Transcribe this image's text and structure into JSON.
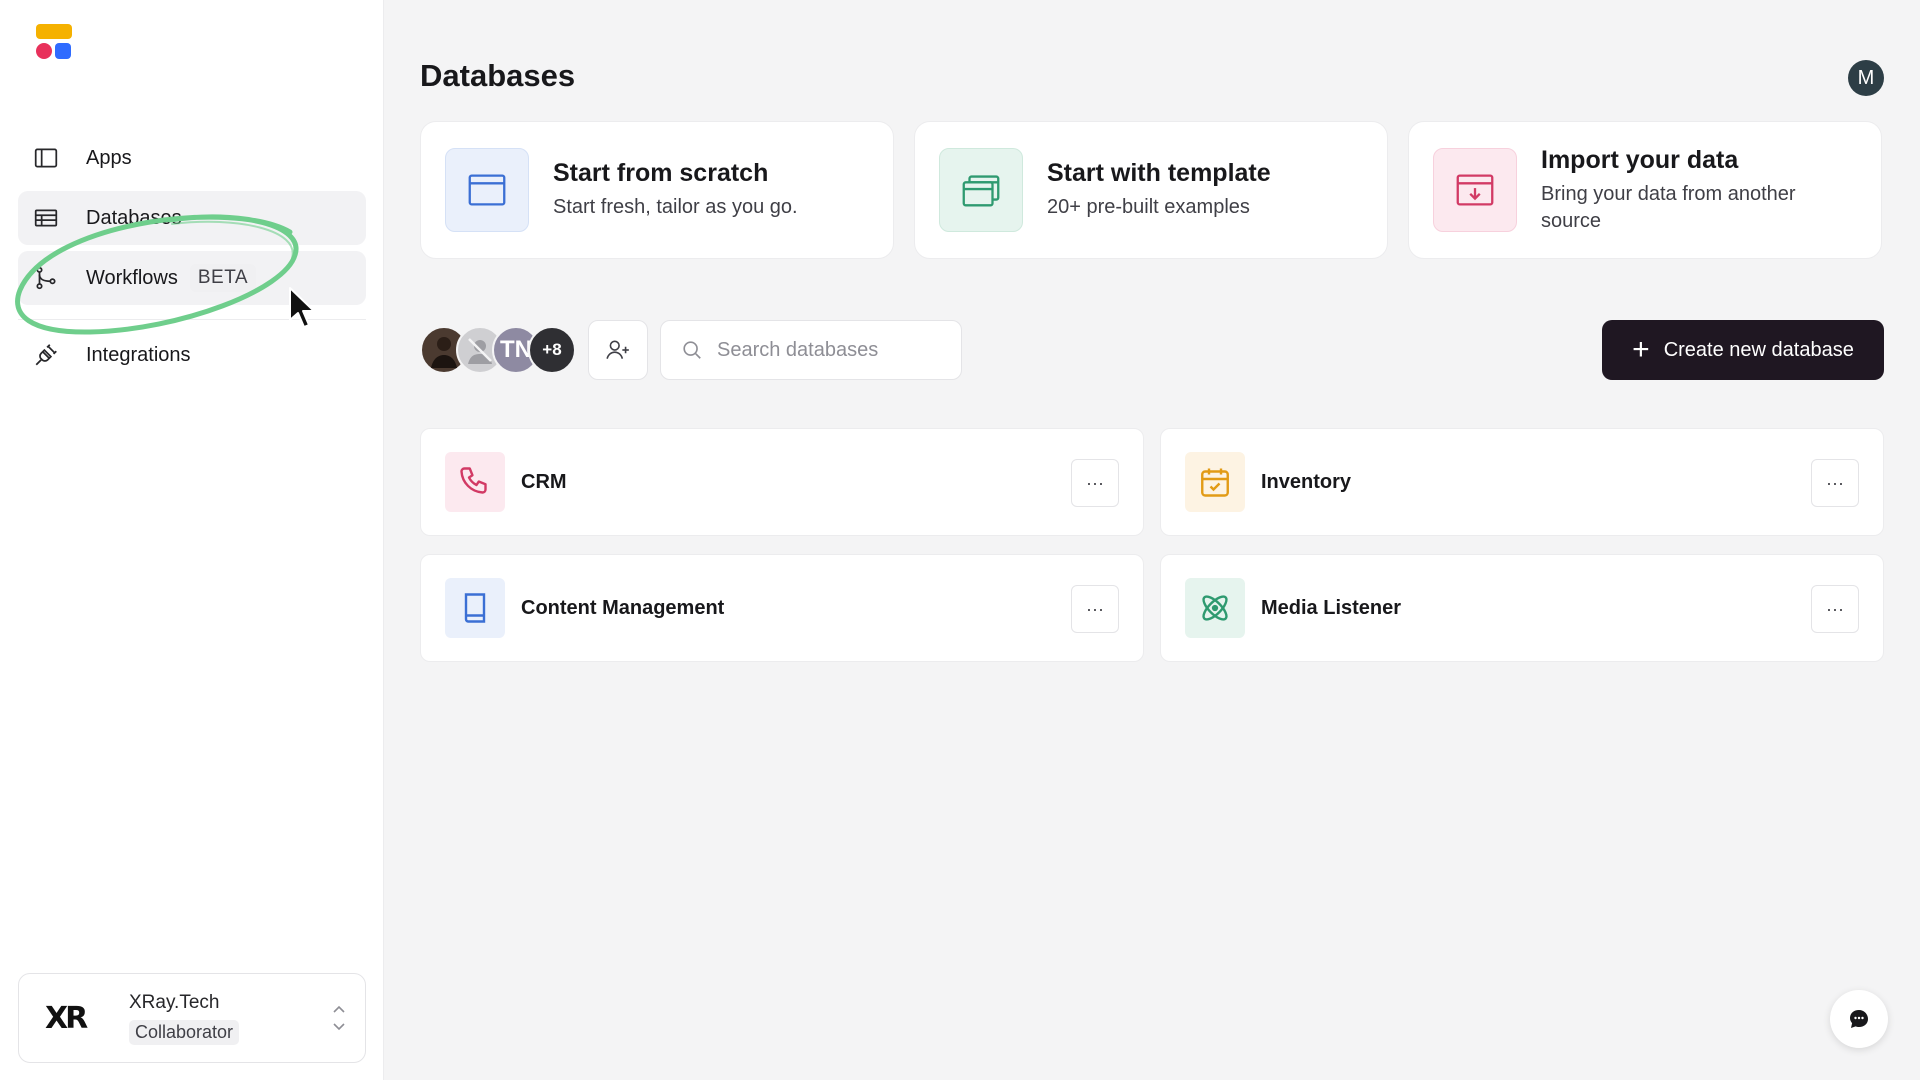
{
  "sidebar": {
    "items": [
      {
        "label": "Apps",
        "icon": "sidebar-panel-icon"
      },
      {
        "label": "Databases",
        "icon": "table-icon"
      },
      {
        "label": "Workflows",
        "badge": "BETA",
        "icon": "workflow-branch-icon"
      },
      {
        "label": "Integrations",
        "icon": "plug-icon"
      }
    ],
    "workspace": {
      "logo_text": "XR",
      "name": "XRay.Tech",
      "role": "Collaborator"
    }
  },
  "header": {
    "title": "Databases",
    "user_initial": "M"
  },
  "start_options": [
    {
      "title": "Start from scratch",
      "subtitle": "Start fresh, tailor as you go.",
      "icon": "window-icon",
      "color": "#3b6fd4",
      "bg": "#eaf0fb"
    },
    {
      "title": "Start with template",
      "subtitle": "20+ pre-built examples",
      "icon": "stacked-windows-icon",
      "color": "#2f9a70",
      "bg": "#e6f4ee"
    },
    {
      "title": "Import your data",
      "subtitle": "Bring your data from another source",
      "icon": "import-icon",
      "color": "#d23a65",
      "bg": "#fce9ef"
    }
  ],
  "toolbar": {
    "collaborators": [
      "",
      "",
      "TN",
      "+8"
    ],
    "search_placeholder": "Search databases",
    "create_label": "Create new database"
  },
  "databases": [
    {
      "name": "CRM",
      "icon": "phone-icon",
      "color": "#d23a65",
      "bg": "#fce9ef"
    },
    {
      "name": "Inventory",
      "icon": "calendar-check-icon",
      "color": "#e29b16",
      "bg": "#fdf3e3"
    },
    {
      "name": "Content Management",
      "icon": "book-icon",
      "color": "#3b6fd4",
      "bg": "#eaf0fb"
    },
    {
      "name": "Media Listener",
      "icon": "atom-icon",
      "color": "#2f9a70",
      "bg": "#e6f4ee"
    }
  ],
  "more_label": "···",
  "colors": {
    "accent_dark": "#1f1722",
    "annotation": "#6fce8c"
  }
}
